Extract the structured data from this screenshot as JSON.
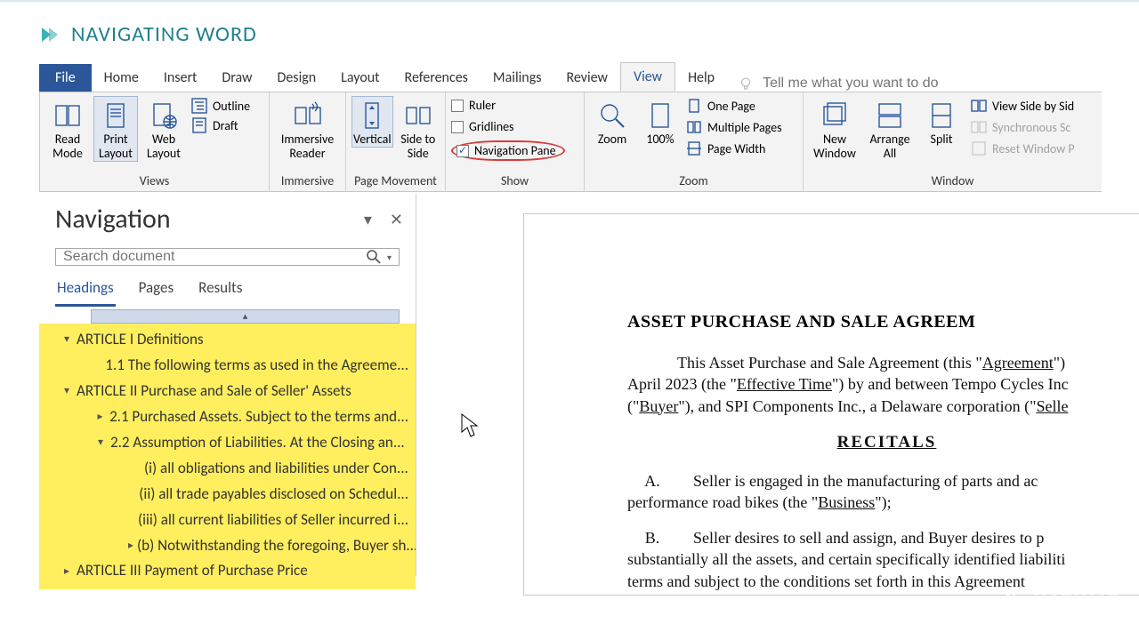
{
  "title": {
    "text": "NAVIGATING WORD"
  },
  "tabs": {
    "file": "File",
    "home": "Home",
    "insert": "Insert",
    "draw": "Draw",
    "design": "Design",
    "layout": "Layout",
    "references": "References",
    "mailings": "Mailings",
    "review": "Review",
    "view": "View",
    "help": "Help",
    "tellme_placeholder": "Tell me what you want to do"
  },
  "ribbon": {
    "views": {
      "label": "Views",
      "read_mode": "Read Mode",
      "print_layout": "Print Layout",
      "web_layout": "Web Layout",
      "outline": "Outline",
      "draft": "Draft"
    },
    "immersive": {
      "label": "Immersive",
      "reader": "Immersive Reader"
    },
    "pagemove": {
      "label": "Page Movement",
      "vertical": "Vertical",
      "side": "Side to Side"
    },
    "show": {
      "label": "Show",
      "ruler": "Ruler",
      "gridlines": "Gridlines",
      "navpane": "Navigation Pane"
    },
    "zoom": {
      "label": "Zoom",
      "zoom": "Zoom",
      "pct": "100%",
      "one_page": "One Page",
      "multiple_pages": "Multiple Pages",
      "page_width": "Page Width"
    },
    "window": {
      "label": "Window",
      "new_window": "New Window",
      "arrange_all": "Arrange All",
      "split": "Split",
      "view_side": "View Side by Sid",
      "sync": "Synchronous Sc",
      "reset": "Reset Window P"
    }
  },
  "navpane": {
    "title": "Navigation",
    "search_placeholder": "Search document",
    "tabs": {
      "headings": "Headings",
      "pages": "Pages",
      "results": "Results"
    },
    "collapse_glyph": "▴",
    "tree": [
      {
        "level": 1,
        "expander": "▾",
        "text": "ARTICLE I  Definitions"
      },
      {
        "level": 2,
        "expander": "",
        "text": "1.1 The following terms as used in the Agreeme..."
      },
      {
        "level": 1,
        "expander": "▾",
        "text": "ARTICLE II  Purchase and Sale of Seller' Assets"
      },
      {
        "level": 2,
        "expander": "▸",
        "text": "2.1 Purchased Assets.  Subject to the terms and..."
      },
      {
        "level": 2,
        "expander": "▾",
        "text": "2.2 Assumption of Liabilities.   At the Closing an..."
      },
      {
        "level": 3,
        "expander": "",
        "text": "(i) all obligations and liabilities under Con..."
      },
      {
        "level": 3,
        "expander": "",
        "text": "(ii) all trade payables disclosed on Schedul..."
      },
      {
        "level": 3,
        "expander": "",
        "text": "(iii) all current liabilities of Seller incurred i..."
      },
      {
        "level": 3,
        "expander": "▸",
        "text": "(b) Notwithstanding the foregoing, Buyer sh..."
      },
      {
        "level": 1,
        "expander": "▸",
        "text": "ARTICLE III  Payment of Purchase Price"
      }
    ]
  },
  "document": {
    "title": "ASSET PURCHASE AND SALE AGREEM",
    "p1_a": "This Asset Purchase and Sale Agreement (this \"",
    "p1_b": "Agreement",
    "p1_c": "\") ",
    "p1_d": "April 2023 (the \"",
    "p1_e": "Effective Time",
    "p1_f": "\") by and between Tempo Cycles Inc",
    "p1_g": "(\"",
    "p1_h": "Buyer",
    "p1_i": "\"), and SPI Components Inc., a Delaware corporation (\"",
    "p1_j": "Selle",
    "recitals": "RECITALS",
    "pa_label": "A.",
    "pa_1": "Seller is engaged in the manufacturing of parts and ac",
    "pa_2": "performance road bikes (the \"",
    "pa_3": "Business",
    "pa_4": "\");",
    "pb_label": "B.",
    "pb_1": "Seller desires to sell and assign, and Buyer desires to p",
    "pb_2": "substantially all the assets, and certain specifically identified liabiliti",
    "pb_3": "terms and subject to the conditions set forth in this Agreement"
  },
  "watermark": "HOTSHOT"
}
